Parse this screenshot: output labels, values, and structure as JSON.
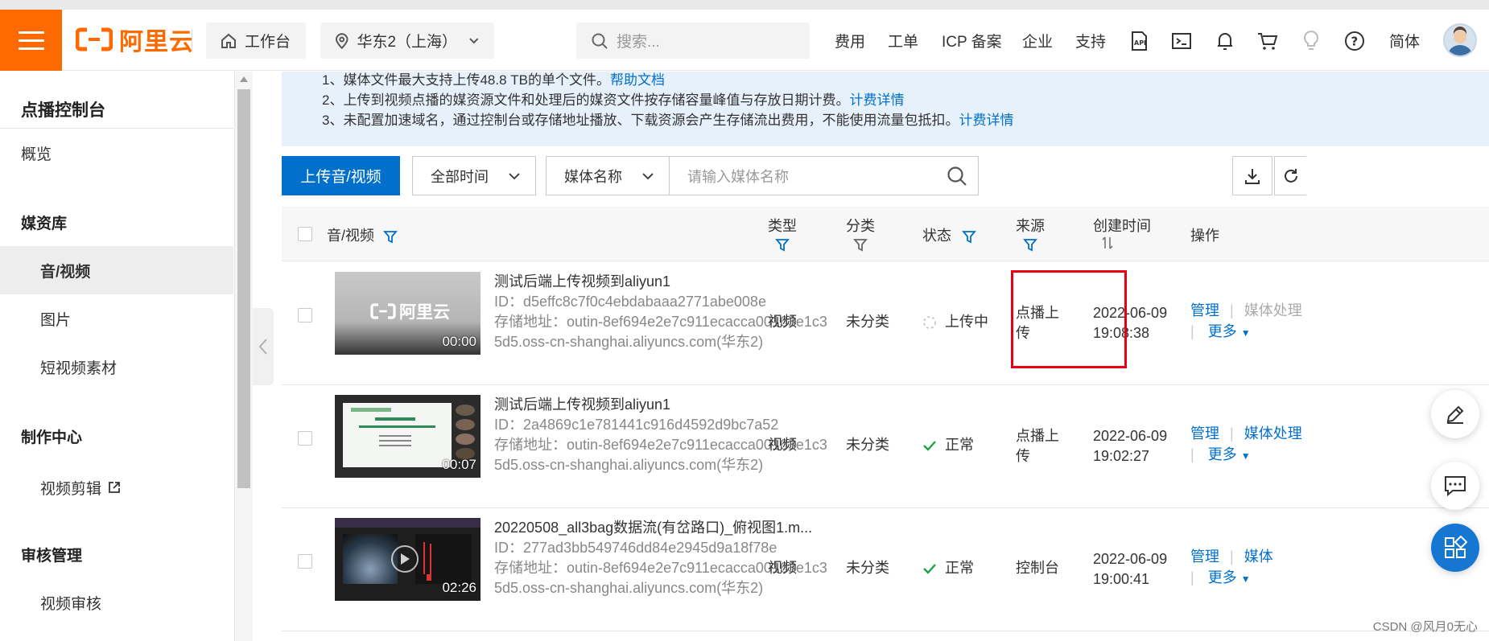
{
  "topbar": {
    "logo_text": "阿里云",
    "workbench_label": "工作台",
    "region_label": "华东2（上海）",
    "search_placeholder": "搜索...",
    "nav": [
      "费用",
      "工单",
      "ICP 备案",
      "企业",
      "支持"
    ],
    "lang_label": "简体"
  },
  "sidebar": {
    "title": "点播控制台",
    "overview": "概览",
    "media_group": "媒资库",
    "media_items": [
      "音/视频",
      "图片",
      "短视频素材"
    ],
    "production_group": "制作中心",
    "production_items": [
      "视频剪辑"
    ],
    "review_group": "审核管理",
    "review_items": [
      "视频审核"
    ]
  },
  "notice": {
    "line1_text": "1、媒体文件最大支持上传48.8 TB的单个文件。",
    "line1_link": "帮助文档",
    "line2_text": "2、上传到视频点播的媒资源文件和处理后的媒资文件按存储容量峰值与存放日期计费。",
    "line2_link": "计费详情",
    "line3_text": "3、未配置加速域名，通过控制台或存储地址播放、下载资源会产生存储流出费用，不能使用流量包抵扣。",
    "line3_link": "计费详情"
  },
  "toolbar": {
    "upload_label": "上传音/视频",
    "time_select": "全部时间",
    "field_select": "媒体名称",
    "search_placeholder": "请输入媒体名称"
  },
  "table": {
    "columns": {
      "media": "音/视频",
      "type": "类型",
      "category": "分类",
      "status": "状态",
      "source": "来源",
      "created": "创建时间",
      "actions": "操作"
    },
    "rows": [
      {
        "title": "测试后端上传视频到aliyun1",
        "id": "ID：d5effc8c7f0c4ebdabaaa2771abe008e",
        "storage": "存储地址：outin-8ef694e2e7c911ecacca00163e1c35d5.oss-cn-shanghai.aliyuncs.com(华东2)",
        "duration": "00:00",
        "thumb_logo": "阿里云",
        "type": "视频",
        "category": "未分类",
        "status": "上传中",
        "source": "点播上传",
        "date": "2022-06-09",
        "time": "19:08:38",
        "action_manage": "管理",
        "action_process": "媒体处理",
        "action_more": "更多"
      },
      {
        "title": "测试后端上传视频到aliyun1",
        "id": "ID：2a4869c1e781441c916d4592d9bc7a52",
        "storage": "存储地址：outin-8ef694e2e7c911ecacca00163e1c35d5.oss-cn-shanghai.aliyuncs.com(华东2)",
        "duration": "00:07",
        "type": "视频",
        "category": "未分类",
        "status": "正常",
        "source": "点播上传",
        "date": "2022-06-09",
        "time": "19:02:27",
        "action_manage": "管理",
        "action_process": "媒体处理",
        "action_more": "更多"
      },
      {
        "title": "20220508_all3bag数据流(有岔路口)_俯视图1.m...",
        "id": "ID：277ad3bb549746dd84e2945d9a18f78e",
        "storage": "存储地址：outin-8ef694e2e7c911ecacca00163e1c35d5.oss-cn-shanghai.aliyuncs.com(华东2)",
        "duration": "02:26",
        "type": "视频",
        "category": "未分类",
        "status": "正常",
        "source": "控制台",
        "date": "2022-06-09",
        "time": "19:00:41",
        "action_manage": "管理",
        "action_process": "媒体",
        "action_more": "更多"
      }
    ]
  },
  "watermark": "CSDN @风月0无心",
  "colors": {
    "brand_orange": "#ff6a00",
    "primary_blue": "#0070cc",
    "notice_bg": "#e7f1fc",
    "success_green": "#1ca348",
    "highlight_red": "#e60012"
  }
}
